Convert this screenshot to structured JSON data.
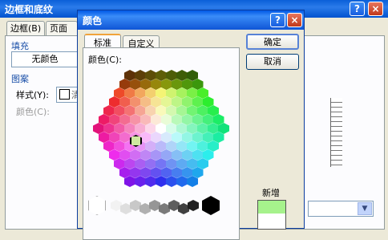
{
  "background_dialog": {
    "title": "边框和底纹",
    "tabs": [
      "边框(B)",
      "页面边"
    ],
    "fill_group": "填充",
    "fill_value": "无颜色",
    "pattern_group": "图案",
    "style_label": "样式(Y):",
    "style_value": "清",
    "color_label": "颜色(C):"
  },
  "color_dialog": {
    "title": "颜色",
    "help_glyph": "?",
    "close_glyph": "×",
    "tabs": [
      "标准",
      "自定义"
    ],
    "colors_label": "颜色(C):",
    "ok_label": "确定",
    "cancel_label": "取消",
    "new_label": "新增",
    "new_color": "#a6f28c",
    "selected_color": "#cfe8a0"
  }
}
